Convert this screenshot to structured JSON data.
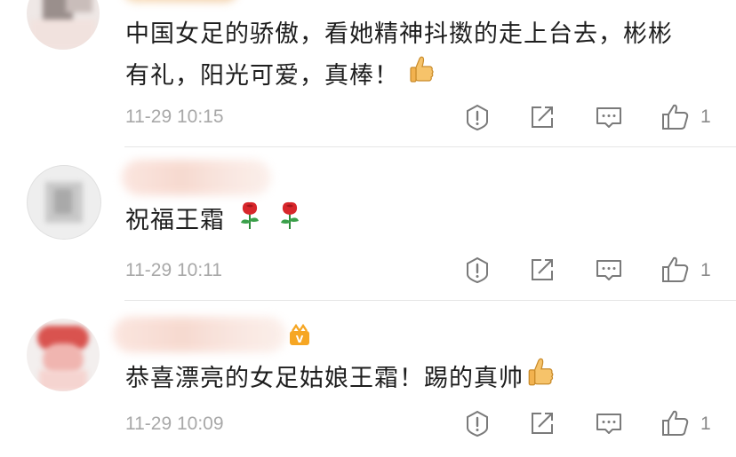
{
  "comments": [
    {
      "text_line1": "中国女足的骄傲，看她精神抖擞的走上台去，彬彬",
      "text_line2": "有礼，阳光可爱，真棒！",
      "time": "11-29 10:15",
      "likes": "1",
      "trailing_icon": "thumbs-up-emoji"
    },
    {
      "text": "祝福王霜",
      "time": "11-29 10:11",
      "likes": "1",
      "trailing_icons": [
        "rose-emoji",
        "rose-emoji"
      ]
    },
    {
      "text": "恭喜漂亮的女足姑娘王霜！踢的真帅",
      "time": "11-29 10:09",
      "likes": "1",
      "trailing_icon": "thumbs-up-emoji"
    }
  ],
  "action_icons": [
    "report-icon",
    "repost-icon",
    "reply-icon",
    "like-icon"
  ],
  "colors": {
    "time": "#a8a8a8",
    "divider": "#e6e6e6",
    "icon": "#7a7a7a",
    "rose": "#d7262b"
  }
}
